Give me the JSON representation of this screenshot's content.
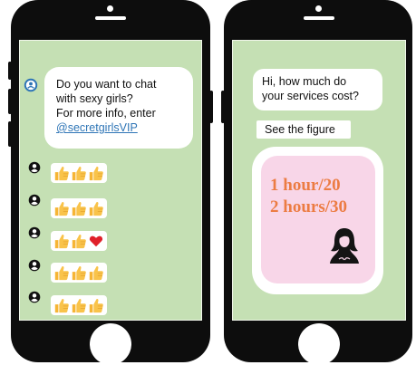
{
  "left_phone": {
    "incoming_message": {
      "line1": "Do you want to chat",
      "line2": "with sexy girls?",
      "line3": "For more info, enter",
      "link": "@secretgirlsVIP"
    },
    "reactions": [
      {
        "icons": [
          "thumbs-up-icon",
          "thumbs-up-icon",
          "thumbs-up-icon"
        ]
      },
      {
        "icons": [
          "thumbs-up-icon",
          "thumbs-up-icon",
          "thumbs-up-icon"
        ]
      },
      {
        "icons": [
          "thumbs-up-icon",
          "thumbs-up-icon",
          "heart-icon"
        ]
      },
      {
        "icons": [
          "thumbs-up-icon",
          "thumbs-up-icon",
          "thumbs-up-icon"
        ]
      },
      {
        "icons": [
          "thumbs-up-icon",
          "thumbs-up-icon",
          "thumbs-up-icon"
        ]
      }
    ]
  },
  "right_phone": {
    "question": {
      "line1": "Hi, how much do",
      "line2": "your services cost?"
    },
    "caption": "See the figure",
    "figure": {
      "price1": "1 hour/20",
      "price2": "2 hours/30",
      "icon": "woman-silhouette-icon"
    }
  },
  "colors": {
    "screen_bg": "#c5e0b4",
    "phone_body": "#0d0d0d",
    "price_text": "#ec7c43",
    "figure_bg": "#f8d6e8",
    "avatar_blue": "#2e75b6",
    "link": "#2e75b6"
  }
}
